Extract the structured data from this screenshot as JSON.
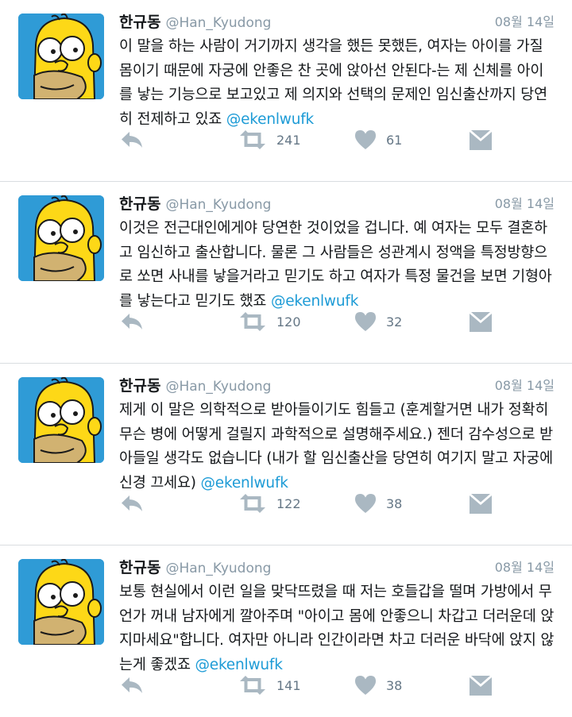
{
  "tweets": [
    {
      "name": "한규동",
      "handle": "@Han_Kyudong",
      "date": "08월 14일",
      "text": "이 말을 하는 사람이 거기까지 생각을 했든 못했든, 여자는 아이를 가질 몸이기 때문에 자궁에 안좋은 찬 곳에 앉아선 안된다-는 제 신체를 아이를 낳는 기능으로 보고있고 제 의지와 선택의 문제인 임신출산까지 당연히 전제하고 있죠",
      "mention": "@ekenlwufk",
      "retweets": "241",
      "likes": "61"
    },
    {
      "name": "한규동",
      "handle": "@Han_Kyudong",
      "date": "08월 14일",
      "text": "이것은 전근대인에게야 당연한 것이었을 겁니다. 예 여자는 모두 결혼하고 임신하고 출산합니다. 물론 그 사람들은 성관계시 정액을 특정방향으로 쏘면 사내를 낳을거라고 믿기도 하고 여자가 특정 물건을 보면 기형아를 낳는다고 믿기도 했죠",
      "mention": "@ekenlwufk",
      "retweets": "120",
      "likes": "32"
    },
    {
      "name": "한규동",
      "handle": "@Han_Kyudong",
      "date": "08월 14일",
      "text": "제게 이 말은 의학적으로 받아들이기도 힘들고 (훈계할거면 내가 정확히 무슨 병에 어떻게 걸릴지 과학적으로 설명해주세요.) 젠더 감수성으로 받아들일 생각도 없습니다 (내가 할 임신출산을 당연히 여기지 말고 자궁에 신경 끄세요)",
      "mention": "@ekenlwufk",
      "retweets": "122",
      "likes": "38"
    },
    {
      "name": "한규동",
      "handle": "@Han_Kyudong",
      "date": "08월 14일",
      "text": "보통 현실에서 이런 일을 맞닥뜨렸을 때 저는 호들갑을 떨며 가방에서 무언가 꺼내 남자에게 깔아주며 \"아이고 몸에 안좋으니 차갑고 더러운데 앉지마세요\"합니다. 여자만 아니라 인간이라면 차고 더러운 바닥에 앉지 않는게 좋겠죠",
      "mention": "@ekenlwufk",
      "retweets": "141",
      "likes": "38"
    }
  ],
  "icons": {
    "reply": "reply-icon",
    "retweet": "retweet-icon",
    "like": "heart-icon",
    "message": "direct-message-icon"
  },
  "colors": {
    "mention": "#1d9bd6",
    "icon": "#aab8c2",
    "avatar_bg": "#2f9bd6",
    "avatar_skin": "#fdd817"
  }
}
